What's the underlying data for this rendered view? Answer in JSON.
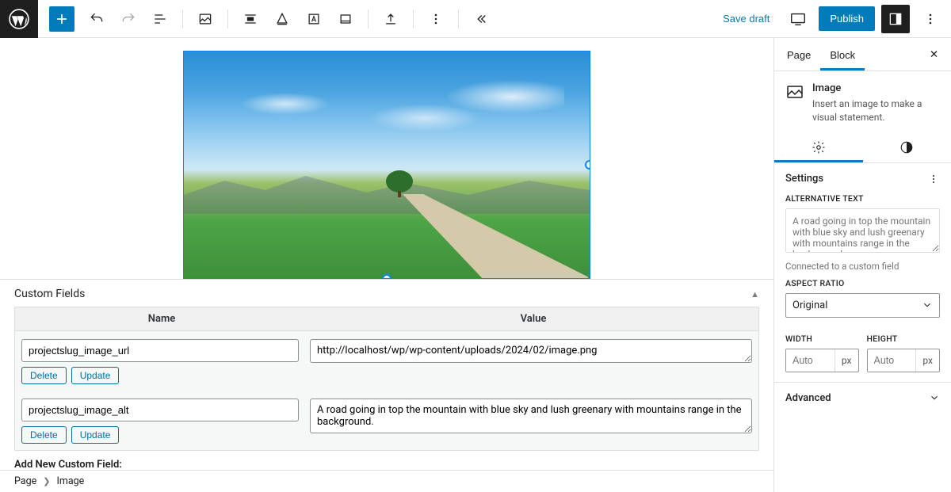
{
  "toolbar": {
    "save_draft": "Save draft",
    "publish": "Publish"
  },
  "custom_fields": {
    "title": "Custom Fields",
    "name_header": "Name",
    "value_header": "Value",
    "delete": "Delete",
    "update": "Update",
    "add_title": "Add New Custom Field:",
    "rows": [
      {
        "name": "projectslug_image_url",
        "value": "http://localhost/wp/wp-content/uploads/2024/02/image.png"
      },
      {
        "name": "projectslug_image_alt",
        "value": "A road going in top the mountain with blue sky and lush greenary with mountains range in the background."
      }
    ]
  },
  "breadcrumb": {
    "root": "Page",
    "leaf": "Image"
  },
  "sidebar": {
    "tab_page": "Page",
    "tab_block": "Block",
    "block_title": "Image",
    "block_desc": "Insert an image to make a visual statement.",
    "settings_title": "Settings",
    "alt_label": "ALTERNATIVE TEXT",
    "alt_placeholder": "A road going in top the mountain with blue sky and lush greenary with mountains range in the background.",
    "alt_help": "Connected to a custom field",
    "aspect_label": "ASPECT RATIO",
    "aspect_value": "Original",
    "width_label": "WIDTH",
    "height_label": "HEIGHT",
    "dim_placeholder": "Auto",
    "dim_unit": "px",
    "advanced": "Advanced"
  }
}
